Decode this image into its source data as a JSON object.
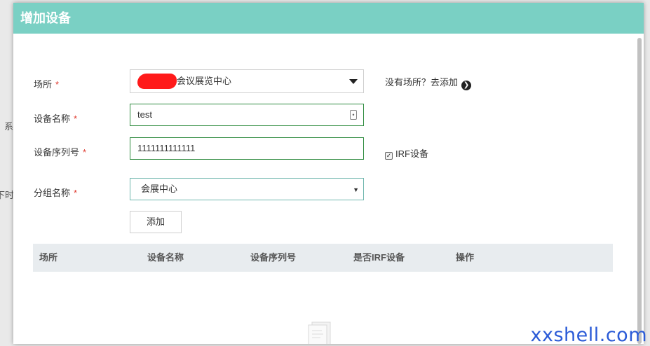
{
  "background": {
    "fragment_1": "系",
    "fragment_2": "下时"
  },
  "modal": {
    "title": "增加设备"
  },
  "form": {
    "place": {
      "label": "场所",
      "value": "会议展览中心",
      "add_link": "没有场所？去添加"
    },
    "device_name": {
      "label": "设备名称",
      "value": "test"
    },
    "serial": {
      "label": "设备序列号",
      "value": "1111111111111"
    },
    "irf": {
      "label": "IRF设备",
      "checked": true
    },
    "group": {
      "label": "分组名称",
      "value": "会展中心"
    },
    "required_mark": "*",
    "add_button": "添加"
  },
  "table": {
    "columns": [
      "场所",
      "设备名称",
      "设备序列号",
      "是否IRF设备",
      "操作"
    ],
    "rows": []
  },
  "watermark": "xxshell.com",
  "colors": {
    "header": "#7ad0c4",
    "required": "#e03c31",
    "valid_border": "#2e8b3e",
    "table_head": "#e8ecef"
  }
}
